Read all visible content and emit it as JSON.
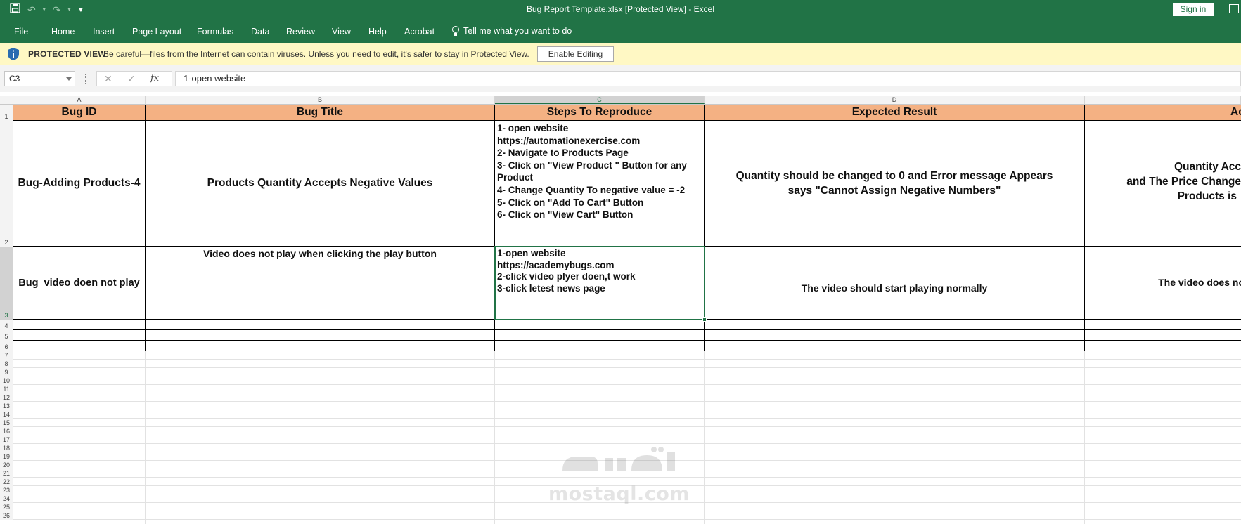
{
  "window": {
    "title": "Bug Report Template.xlsx  [Protected View]  -  Excel",
    "sign_in": "Sign in"
  },
  "ribbon": {
    "tabs": [
      "File",
      "Home",
      "Insert",
      "Page Layout",
      "Formulas",
      "Data",
      "Review",
      "View",
      "Help",
      "Acrobat"
    ],
    "tell_me": "Tell me what you want to do"
  },
  "protected_view": {
    "title": "PROTECTED VIEW",
    "message": "Be careful—files from the Internet can contain viruses. Unless you need to edit, it's safer to stay in Protected View.",
    "button": "Enable Editing"
  },
  "formula_bar": {
    "name_box": "C3",
    "fx": "fx",
    "content": "1-open website"
  },
  "sheet": {
    "columns": [
      "A",
      "B",
      "C",
      "D"
    ],
    "selected_column": "C",
    "row_numbers": [
      "1",
      "2",
      "3",
      "4",
      "5",
      "6",
      "7",
      "8",
      "9",
      "10",
      "11",
      "12",
      "13",
      "14",
      "15",
      "16",
      "17",
      "18",
      "19",
      "20",
      "21",
      "22",
      "23",
      "24",
      "25",
      "26"
    ],
    "headers": [
      "Bug ID",
      "Bug Title",
      "Steps To Reproduce",
      "Expected Result",
      "Ac"
    ],
    "rows": [
      {
        "bug_id": "Bug-Adding Products-4",
        "bug_title": "Products Quantity Accepts Negative Values",
        "steps": "1- open website\nhttps://automationexercise.com\n2- Navigate to Products Page\n3- Click on \"View Product \" Button for any Product\n4- Change Quantity To negative value = -2\n5- Click on \"Add To Cart\" Button\n6- Click on \"View Cart\" Button",
        "expected": "Quantity should be changed to 0 and Error message Appears says \"Cannot Assign Negative Numbers\"",
        "actual_lines": [
          "Quantity Acc",
          "and  The Price Change",
          "Products is"
        ]
      },
      {
        "bug_id": "Bug_video doen not play",
        "bug_title": "Video does not play when clicking the play button",
        "steps": "1-open website\nhttps://academybugs.com\n2-click video plyer doen,t work\n3-click letest news page",
        "expected": "The video should start playing normally",
        "actual_lines": [
          "The video does not pl"
        ]
      }
    ]
  },
  "watermark": {
    "text": "mostaql.com"
  },
  "colors": {
    "excel_green": "#217346",
    "header_fill": "#f4b183",
    "protected_bar": "#fff8c4"
  }
}
